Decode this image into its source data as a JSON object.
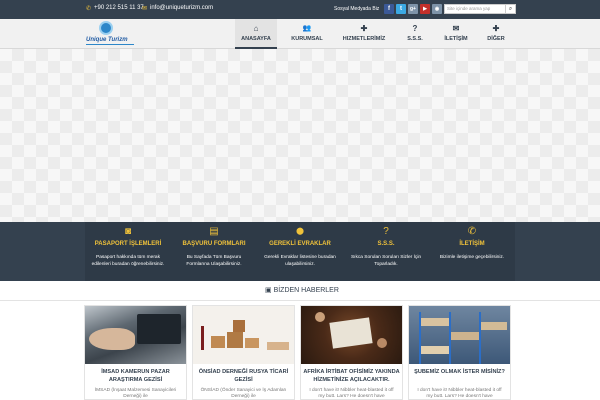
{
  "topbar": {
    "phone": "+90 212 515 11 37",
    "email": "info@uniqueturizm.com",
    "social_label": "Sosyal Medyada Biz",
    "search_placeholder": "Site içinde arama yap",
    "social": [
      {
        "name": "facebook",
        "glyph": "f",
        "color": "#3b5998"
      },
      {
        "name": "twitter",
        "glyph": "t",
        "color": "#3ba9e3"
      },
      {
        "name": "google-plus",
        "glyph": "g+",
        "color": "#7e93a8"
      },
      {
        "name": "youtube",
        "glyph": "▶",
        "color": "#c4302b"
      },
      {
        "name": "rss",
        "glyph": "◉",
        "color": "#7e93a8"
      }
    ]
  },
  "logo": {
    "text": "Unique Turizm"
  },
  "nav": [
    {
      "label": "ANASAYFA",
      "icon": "home-icon",
      "glyph": "⌂",
      "active": true
    },
    {
      "label": "KURUMSAL",
      "icon": "group-icon",
      "glyph": "👥",
      "active": false
    },
    {
      "label": "HIZMETLERİMİZ",
      "icon": "plus-icon",
      "glyph": "✚",
      "active": false
    },
    {
      "label": "S.S.S.",
      "icon": "question-icon",
      "glyph": "?",
      "active": false
    },
    {
      "label": "İLETİŞİM",
      "icon": "envelope-icon",
      "glyph": "✉",
      "active": false
    },
    {
      "label": "DİĞER",
      "icon": "plus-icon",
      "glyph": "✚",
      "active": false
    }
  ],
  "features": [
    {
      "title": "PASAPORT İŞLEMLERİ",
      "desc": "Pasaport hakkında tüm merak edilenleri buradan öğrenebilirsiniz.",
      "icon": "camera-icon",
      "glyph": "◙"
    },
    {
      "title": "BAŞVURU FORMLARI",
      "desc": "Bu Sayfada Tüm Başvuru Formlarına Ulaşabilirsiniz.",
      "icon": "pdf-icon",
      "glyph": "▤"
    },
    {
      "title": "GEREKLİ EVRAKLAR",
      "desc": "Gerekli Evraklar listesine buradan ulaşabilirsiniz.",
      "icon": "map-marker-icon",
      "glyph": "⬤"
    },
    {
      "title": "S.S.S.",
      "desc": "Sıkca Sorulan Soruları Sizler İçin Topar­ladık.",
      "icon": "question-icon",
      "glyph": "?"
    },
    {
      "title": "İLETİŞİM",
      "desc": "Bizimle iletişime geçebilirsiniz.",
      "icon": "phone-icon",
      "glyph": "✆"
    }
  ],
  "news": {
    "heading": "BİZDEN HABERLER",
    "cards": [
      {
        "title": "İMSAD KAMERUN PAZAR ARAŞTIRMA GEZİSİ",
        "excerpt": "İMSAD (İnşaat Malzemesi Sanayicileri Derneği) ile"
      },
      {
        "title": "ÖNSİAD DERNEĞİ RUSYA TİCARİ GEZİSİ",
        "excerpt": "ÖNSİAD (Önder Sanayici ve İş Adamları Derneği) ile"
      },
      {
        "title": "AFRİKA İRTİBAT OFİSİMİZ YAKINDA HİZMETİNİZE AÇILACAKTIR.",
        "excerpt": "I don't have it! Nibbler heat-blasted it off my butt. Lars? He doesn't have"
      },
      {
        "title": "ŞUBEMİZ OLMAK İSTER MİSİNİZ?",
        "excerpt": "I don't have it! Nibbler heat-blasted it off my butt. Lars? He doesn't have"
      }
    ]
  },
  "colors": {
    "dark": "#34414f",
    "accent": "#f0c23a",
    "brand": "#2d87c9"
  }
}
